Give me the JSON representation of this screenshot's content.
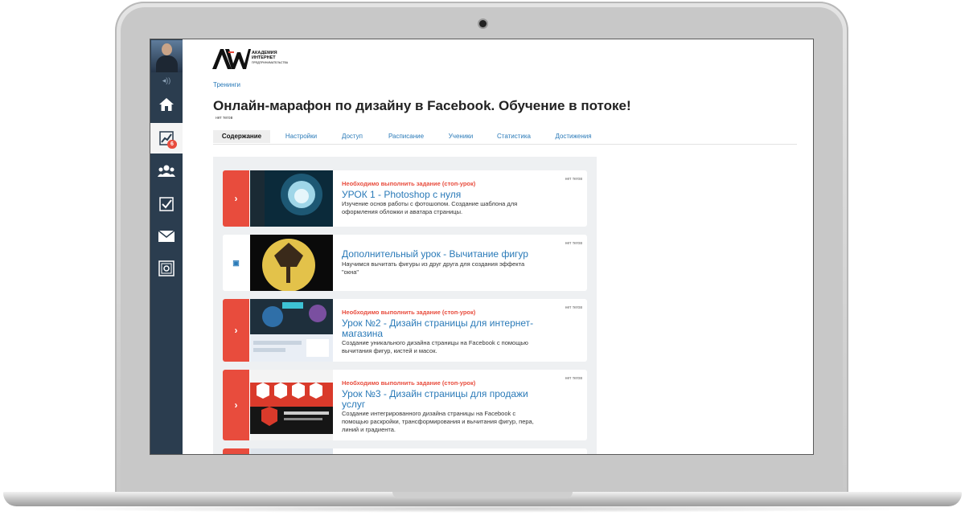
{
  "sidebar": {
    "badge_count": "6",
    "items": [
      "home-icon",
      "chart-icon",
      "users-icon",
      "checkbox-icon",
      "mail-icon",
      "safe-icon"
    ]
  },
  "logo": {
    "line1": "АКАДЕМИЯ",
    "line2": "ИНТЕРНЕТ",
    "line3": "ПРЕДПРИНИМАТЕЛЬСТВА"
  },
  "breadcrumb": "Тренинги",
  "page": {
    "title": "Онлайн-марафон по дизайну в Facebook. Обучение в потоке!",
    "status": "нет тегов"
  },
  "tabs": [
    "Содержание",
    "Настройки",
    "Доступ",
    "Расписание",
    "Ученики",
    "Статистика",
    "Достижения"
  ],
  "lessons": [
    {
      "warning": "Необходимо выполнить задание (стоп-урок)",
      "title": "УРОК 1 - Photoshop с нуля",
      "desc": "Изучение основ работы с фотошопом. Создание шаблона для оформления обложки и аватара страницы.",
      "status": "нет тегов"
    },
    {
      "warning": "",
      "title": "Дополнительный урок - Вычитание фигур",
      "desc": "Научимся вычитать фигуры из друг друга для создания эффекта \"окна\"",
      "status": "нет тегов"
    },
    {
      "warning": "Необходимо выполнить задание (стоп-урок)",
      "title": "Урок №2 - Дизайн страницы для интернет-магазина",
      "desc": "Создание уникального дизайна страницы на Facebook с помощью вычитания фигур, кистей и масок.",
      "status": "нет тегов"
    },
    {
      "warning": "Необходимо выполнить задание (стоп-урок)",
      "title": "Урок №3 - Дизайн страницы для продажи услуг",
      "desc": "Создание интегрированного дизайна страницы на Facebook с помощью раскройки, трансформирования и вычитания фигур, пера, линий и градиента.",
      "status": "нет тегов"
    }
  ],
  "colors": {
    "accent": "#e84c3d",
    "link": "#2a7ab8",
    "sidebar": "#2b3d4f"
  }
}
